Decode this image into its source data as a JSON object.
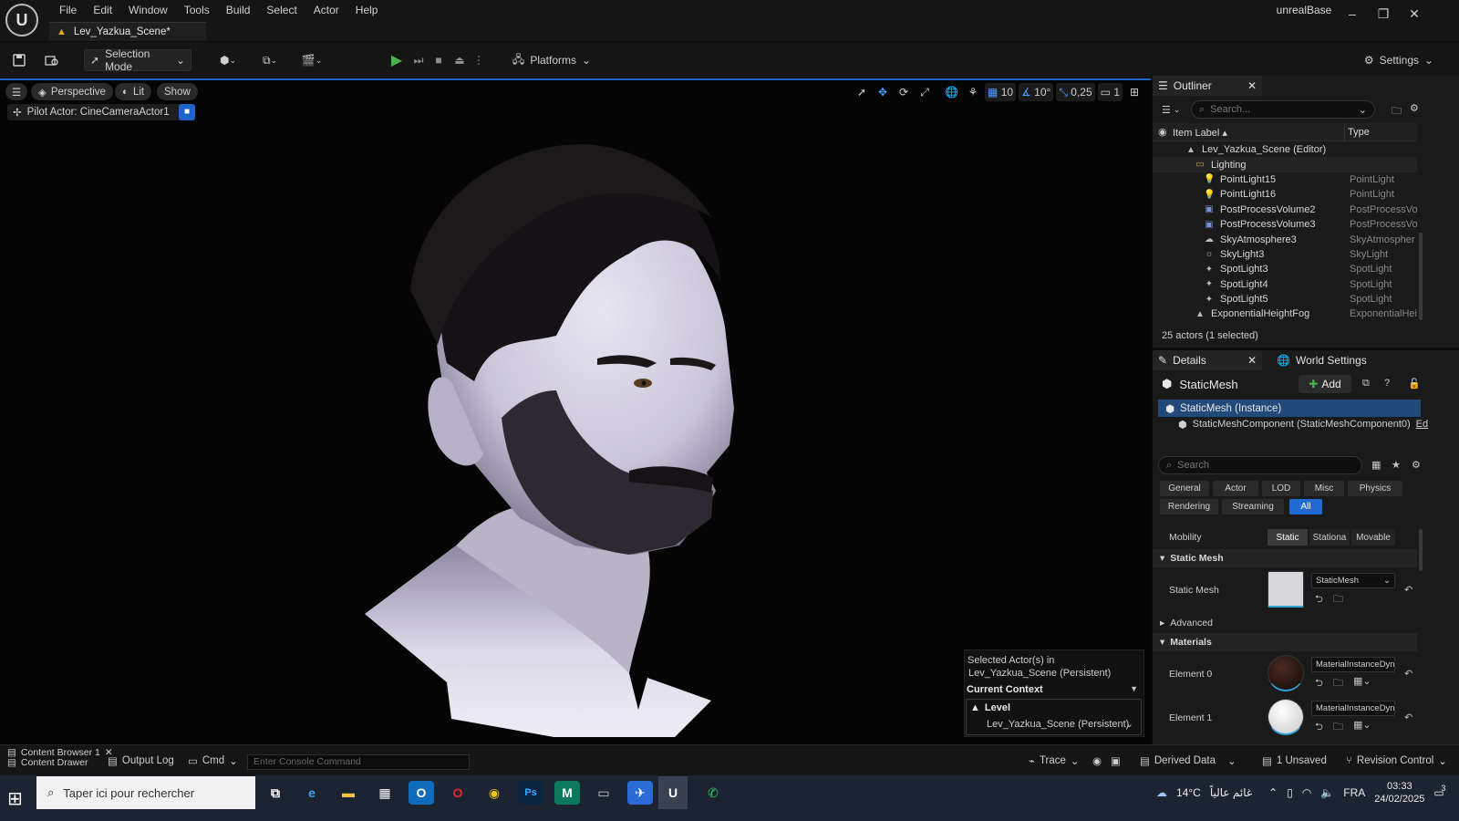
{
  "app": {
    "logo_text": "U",
    "menu": [
      "File",
      "Edit",
      "Window",
      "Tools",
      "Build",
      "Select",
      "Actor",
      "Help"
    ],
    "doc_tab": "Lev_Yazkua_Scene*",
    "project": "unrealBase"
  },
  "toolbar": {
    "selection_mode": "Selection Mode",
    "platforms": "Platforms",
    "settings": "Settings"
  },
  "viewport": {
    "perspective": "Perspective",
    "lit": "Lit",
    "show": "Show",
    "pilot": "Pilot Actor: CineCameraActor1",
    "grid_snap": "10",
    "rot_snap": "10°",
    "scale_snap": "0,25",
    "cam_speed": "1",
    "context": {
      "selected_line1": "Selected Actor(s) in",
      "selected_line2": "Lev_Yazkua_Scene (Persistent)",
      "current_context": "Current Context",
      "level_label": "Level",
      "level_value": "Lev_Yazkua_Scene (Persistent)"
    }
  },
  "outliner": {
    "tab": "Outliner",
    "search_placeholder": "Search...",
    "col_label": "Item Label",
    "col_type": "Type",
    "rows": [
      {
        "label": "Lev_Yazkua_Scene (Editor)",
        "type": "",
        "icon": "level-icon"
      },
      {
        "label": "Lighting",
        "type": "",
        "icon": "folder-icon"
      },
      {
        "label": "PointLight15",
        "type": "PointLight",
        "icon": "pointlight-icon"
      },
      {
        "label": "PointLight16",
        "type": "PointLight",
        "icon": "pointlight-icon"
      },
      {
        "label": "PostProcessVolume2",
        "type": "PostProcessVo",
        "icon": "postprocess-icon"
      },
      {
        "label": "PostProcessVolume3",
        "type": "PostProcessVo",
        "icon": "postprocess-icon"
      },
      {
        "label": "SkyAtmosphere3",
        "type": "SkyAtmospher",
        "icon": "skyatmosphere-icon"
      },
      {
        "label": "SkyLight3",
        "type": "SkyLight",
        "icon": "skylight-icon"
      },
      {
        "label": "SpotLight3",
        "type": "SpotLight",
        "icon": "spotlight-icon"
      },
      {
        "label": "SpotLight4",
        "type": "SpotLight",
        "icon": "spotlight-icon"
      },
      {
        "label": "SpotLight5",
        "type": "SpotLight",
        "icon": "spotlight-icon"
      },
      {
        "label": "ExponentialHeightFog",
        "type": "ExponentialHei",
        "icon": "fog-icon"
      }
    ],
    "footer": "25 actors (1 selected)"
  },
  "details": {
    "tab": "Details",
    "tab2": "World Settings",
    "title": "StaticMesh",
    "add": "Add",
    "instance": "StaticMesh (Instance)",
    "component": "StaticMeshComponent (StaticMeshComponent0)",
    "component_edit": "Ed",
    "search_placeholder": "Search",
    "categories_row1": [
      "General",
      "Actor",
      "LOD",
      "Misc",
      "Physics"
    ],
    "categories_row2": [
      "Rendering",
      "Streaming",
      "All"
    ],
    "mobility_label": "Mobility",
    "mobility": [
      "Static",
      "Stationa",
      "Movable"
    ],
    "section_static_mesh": "Static Mesh",
    "static_mesh_label": "Static Mesh",
    "static_mesh_value": "StaticMesh",
    "advanced": "Advanced",
    "section_materials": "Materials",
    "element0": "Element 0",
    "element0_value": "MaterialInstanceDyna",
    "element1": "Element 1",
    "element1_value": "MaterialInstanceDyna"
  },
  "bottom": {
    "content_browser_tab": "Content Browser 1",
    "content_drawer": "Content Drawer",
    "output_log": "Output Log",
    "cmd": "Cmd",
    "console_placeholder": "Enter Console Command",
    "trace": "Trace",
    "derived_data": "Derived Data",
    "unsaved": "1 Unsaved",
    "revision_control": "Revision Control"
  },
  "taskbar": {
    "search": "Taper ici pour rechercher",
    "weather": "14°C",
    "weather_text": "غائم عالياً",
    "lang": "FRA",
    "time": "03:33",
    "date": "24/02/2025",
    "notif": "3"
  }
}
